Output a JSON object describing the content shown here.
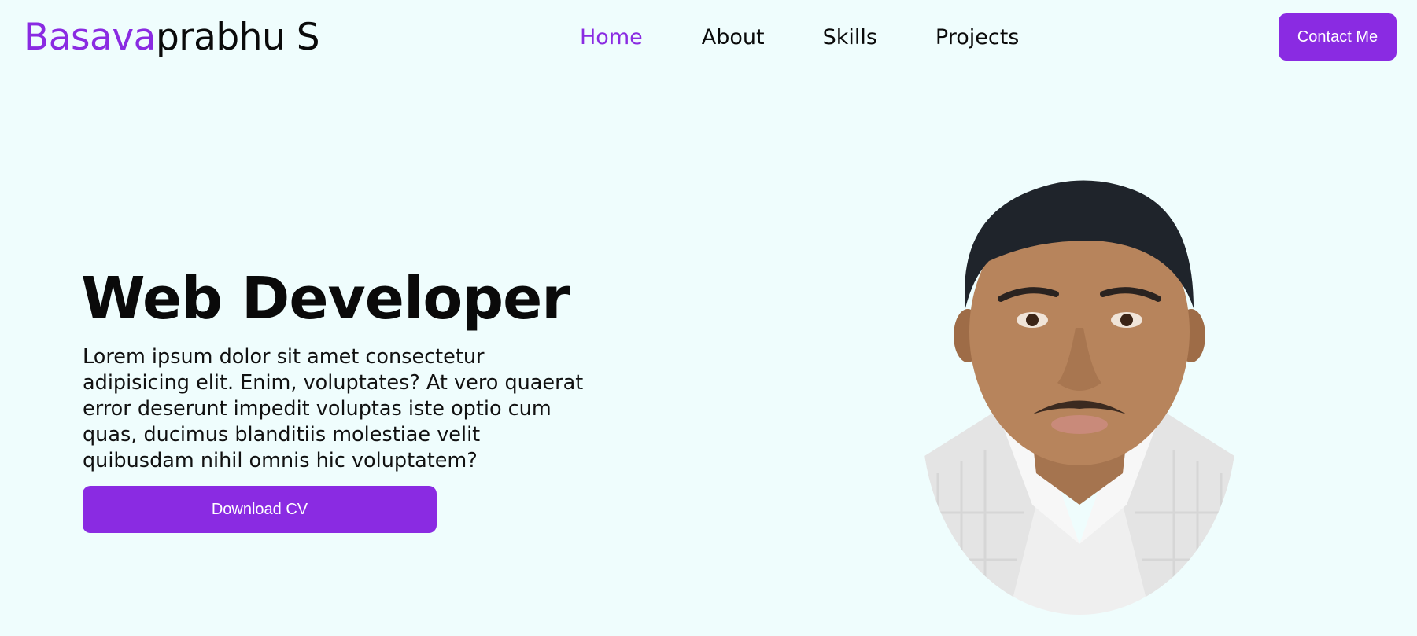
{
  "colors": {
    "accent": "#8a2be2",
    "background": "#effdfd",
    "text": "#0a0a0a"
  },
  "header": {
    "logo_accent": "Basava",
    "logo_rest": "prabhu S",
    "nav": [
      {
        "label": "Home",
        "active": true
      },
      {
        "label": "About",
        "active": false
      },
      {
        "label": "Skills",
        "active": false
      },
      {
        "label": "Projects",
        "active": false
      }
    ],
    "contact_label": "Contact Me"
  },
  "hero": {
    "title": "Web Developer",
    "description": "Lorem ipsum dolor sit amet consectetur adipisicing elit. Enim, voluptates? At vero quaerat error deserunt impedit voluptas iste optio cum quas, ducimus blanditiis molestiae velit quibusdam nihil omnis hic voluptatem?",
    "download_label": "Download CV"
  },
  "portrait": {
    "icon": "profile-photo"
  }
}
